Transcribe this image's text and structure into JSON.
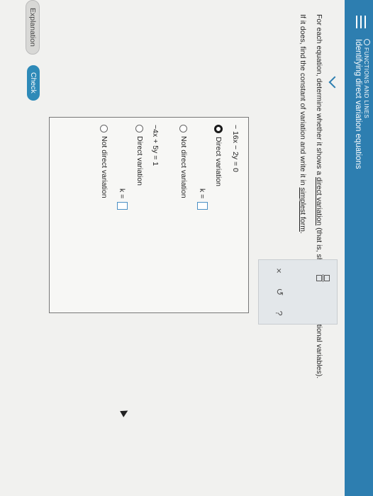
{
  "header": {
    "category": "FUNCTIONS AND LINES",
    "title": "Identifying direct variation equations"
  },
  "instructions": {
    "line1_pre": "For each equation, determine whether it shows a ",
    "line1_link": "direct variation",
    "line1_post": " (that is, shows directly proportional variables).",
    "line2_pre": "If it does, find the constant of variation and write it in ",
    "line2_link": "simplest form",
    "line2_post": "."
  },
  "problems": [
    {
      "equation": "− 16x − 2y = 0",
      "option_direct": "Direct variation",
      "option_not": "Not direct variation",
      "k_label": "k =",
      "selected": "direct"
    },
    {
      "equation": "−4x + 5y = 1",
      "option_direct": "Direct variation",
      "option_not": "Not direct variation",
      "k_label": "k =",
      "selected": "none"
    }
  ],
  "toolbox": {
    "icons": [
      "fraction-icon",
      "close-icon",
      "undo-icon",
      "help-icon"
    ],
    "close_glyph": "×",
    "undo_glyph": "↺",
    "help_glyph": "?"
  },
  "buttons": {
    "explanation": "Explanation",
    "check": "Check"
  },
  "colors": {
    "header": "#2d7eb0",
    "check_button": "#2e8ab8"
  }
}
